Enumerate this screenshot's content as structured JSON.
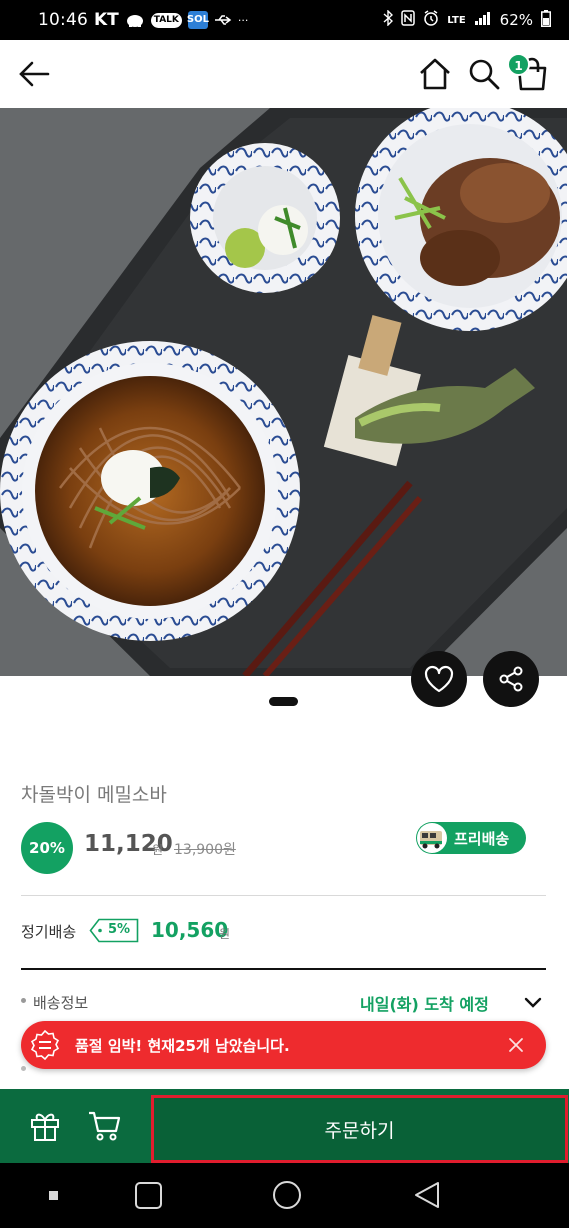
{
  "status_bar": {
    "time": "10:46",
    "carrier": "KT",
    "talk_label": "TALK",
    "sol_label": "SOL",
    "dots": "···",
    "network": "LTE",
    "battery": "62%"
  },
  "nav": {
    "cart_count": "1"
  },
  "product": {
    "name": "차돌박이 메밀소바",
    "discount": "20%",
    "price": "11,120",
    "won": "원",
    "original_price": "13,900원",
    "free_shipping": "프리배송"
  },
  "subscription": {
    "label": "정기배송",
    "discount": "5%",
    "price": "10,560",
    "won": "원"
  },
  "shipping": {
    "label": "배송정보",
    "eta": "내일(화) 도착 예정"
  },
  "toast": {
    "message": "품절 임박! 현재25개 남았습니다."
  },
  "actions": {
    "order_label": "주문하기"
  },
  "colors": {
    "brand_green": "#13a162",
    "action_green": "#096137",
    "toast_red": "#ee2b2e"
  }
}
